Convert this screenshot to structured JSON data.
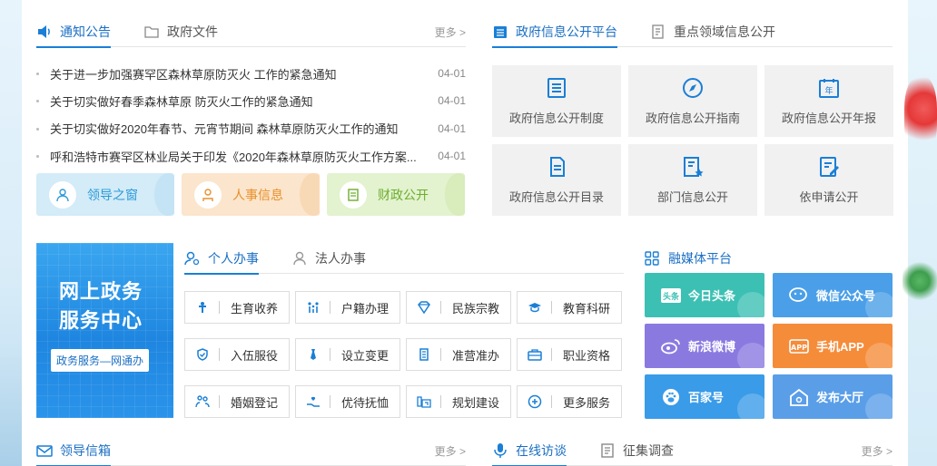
{
  "notice_tabs": [
    {
      "label": "通知公告",
      "icon": "speaker-icon"
    },
    {
      "label": "政府文件",
      "icon": "folder-icon"
    }
  ],
  "notice_more": "更多 >",
  "notices": [
    {
      "title": "关于进一步加强赛罕区森林草原防灭火 工作的紧急通知",
      "date": "04-01"
    },
    {
      "title": "关于切实做好春季森林草原 防灭火工作的紧急通知",
      "date": "04-01"
    },
    {
      "title": "关于切实做好2020年春节、元宵节期间 森林草原防灭火工作的通知",
      "date": "04-01"
    },
    {
      "title": "呼和浩特市赛罕区林业局关于印发《2020年森林草原防灭火工作方案...",
      "date": "04-01"
    }
  ],
  "quick_buttons": [
    {
      "label": "领导之窗",
      "icon": "people-icon",
      "color": "#2a9bd8"
    },
    {
      "label": "人事信息",
      "icon": "person-icon",
      "color": "#e8902a"
    },
    {
      "label": "财政公开",
      "icon": "document-icon",
      "color": "#6cae2e"
    }
  ],
  "info_tabs": [
    {
      "label": "政府信息公开平台",
      "icon": "list-icon"
    },
    {
      "label": "重点领域信息公开",
      "icon": "report-icon"
    }
  ],
  "info_items": [
    {
      "label": "政府信息公开制度",
      "icon": "document-list-icon"
    },
    {
      "label": "政府信息公开指南",
      "icon": "compass-icon"
    },
    {
      "label": "政府信息公开年报",
      "icon": "calendar-year-icon"
    },
    {
      "label": "政府信息公开目录",
      "icon": "files-icon"
    },
    {
      "label": "部门信息公开",
      "icon": "document-star-icon"
    },
    {
      "label": "依申请公开",
      "icon": "edit-document-icon"
    }
  ],
  "banner": {
    "title_line1": "网上政务",
    "title_line2": "服务中心",
    "subtitle": "政务服务—网通办"
  },
  "service_tabs": [
    {
      "label": "个人办事",
      "icon": "person-search-icon"
    },
    {
      "label": "法人办事",
      "icon": "person-outline-icon"
    }
  ],
  "services": [
    {
      "label": "生育收养",
      "icon": "child-icon"
    },
    {
      "label": "户籍办理",
      "icon": "family-icon"
    },
    {
      "label": "民族宗教",
      "icon": "diamond-icon"
    },
    {
      "label": "教育科研",
      "icon": "graduation-cap-icon"
    },
    {
      "label": "入伍服役",
      "icon": "shield-icon"
    },
    {
      "label": "设立变更",
      "icon": "tie-icon"
    },
    {
      "label": "准营准办",
      "icon": "building-icon"
    },
    {
      "label": "职业资格",
      "icon": "briefcase-icon"
    },
    {
      "label": "婚姻登记",
      "icon": "couple-icon"
    },
    {
      "label": "优待抚恤",
      "icon": "hand-heart-icon"
    },
    {
      "label": "规划建设",
      "icon": "blueprint-icon"
    },
    {
      "label": "更多服务",
      "icon": "plus-circle-icon"
    }
  ],
  "media_title": "融媒体平台",
  "media_items": [
    {
      "label": "今日头条",
      "icon": "toutiao-icon",
      "color": "#3cc0b4"
    },
    {
      "label": "微信公众号",
      "icon": "wechat-icon",
      "color": "#4a9fe8"
    },
    {
      "label": "新浪微博",
      "icon": "weibo-icon",
      "color": "#8a7ae0"
    },
    {
      "label": "手机APP",
      "icon": "app-icon",
      "color": "#f58c3a"
    },
    {
      "label": "百家号",
      "icon": "paw-icon",
      "color": "#3a9be8"
    },
    {
      "label": "发布大厅",
      "icon": "house-icon",
      "color": "#5a9ee8"
    }
  ],
  "bottom_left_tab": {
    "label": "领导信箱",
    "icon": "mail-icon"
  },
  "bottom_left_more": "更多 >",
  "bottom_right_tabs": [
    {
      "label": "在线访谈",
      "icon": "microphone-icon"
    },
    {
      "label": "征集调查",
      "icon": "survey-icon"
    }
  ],
  "bottom_right_more": "更多 >"
}
